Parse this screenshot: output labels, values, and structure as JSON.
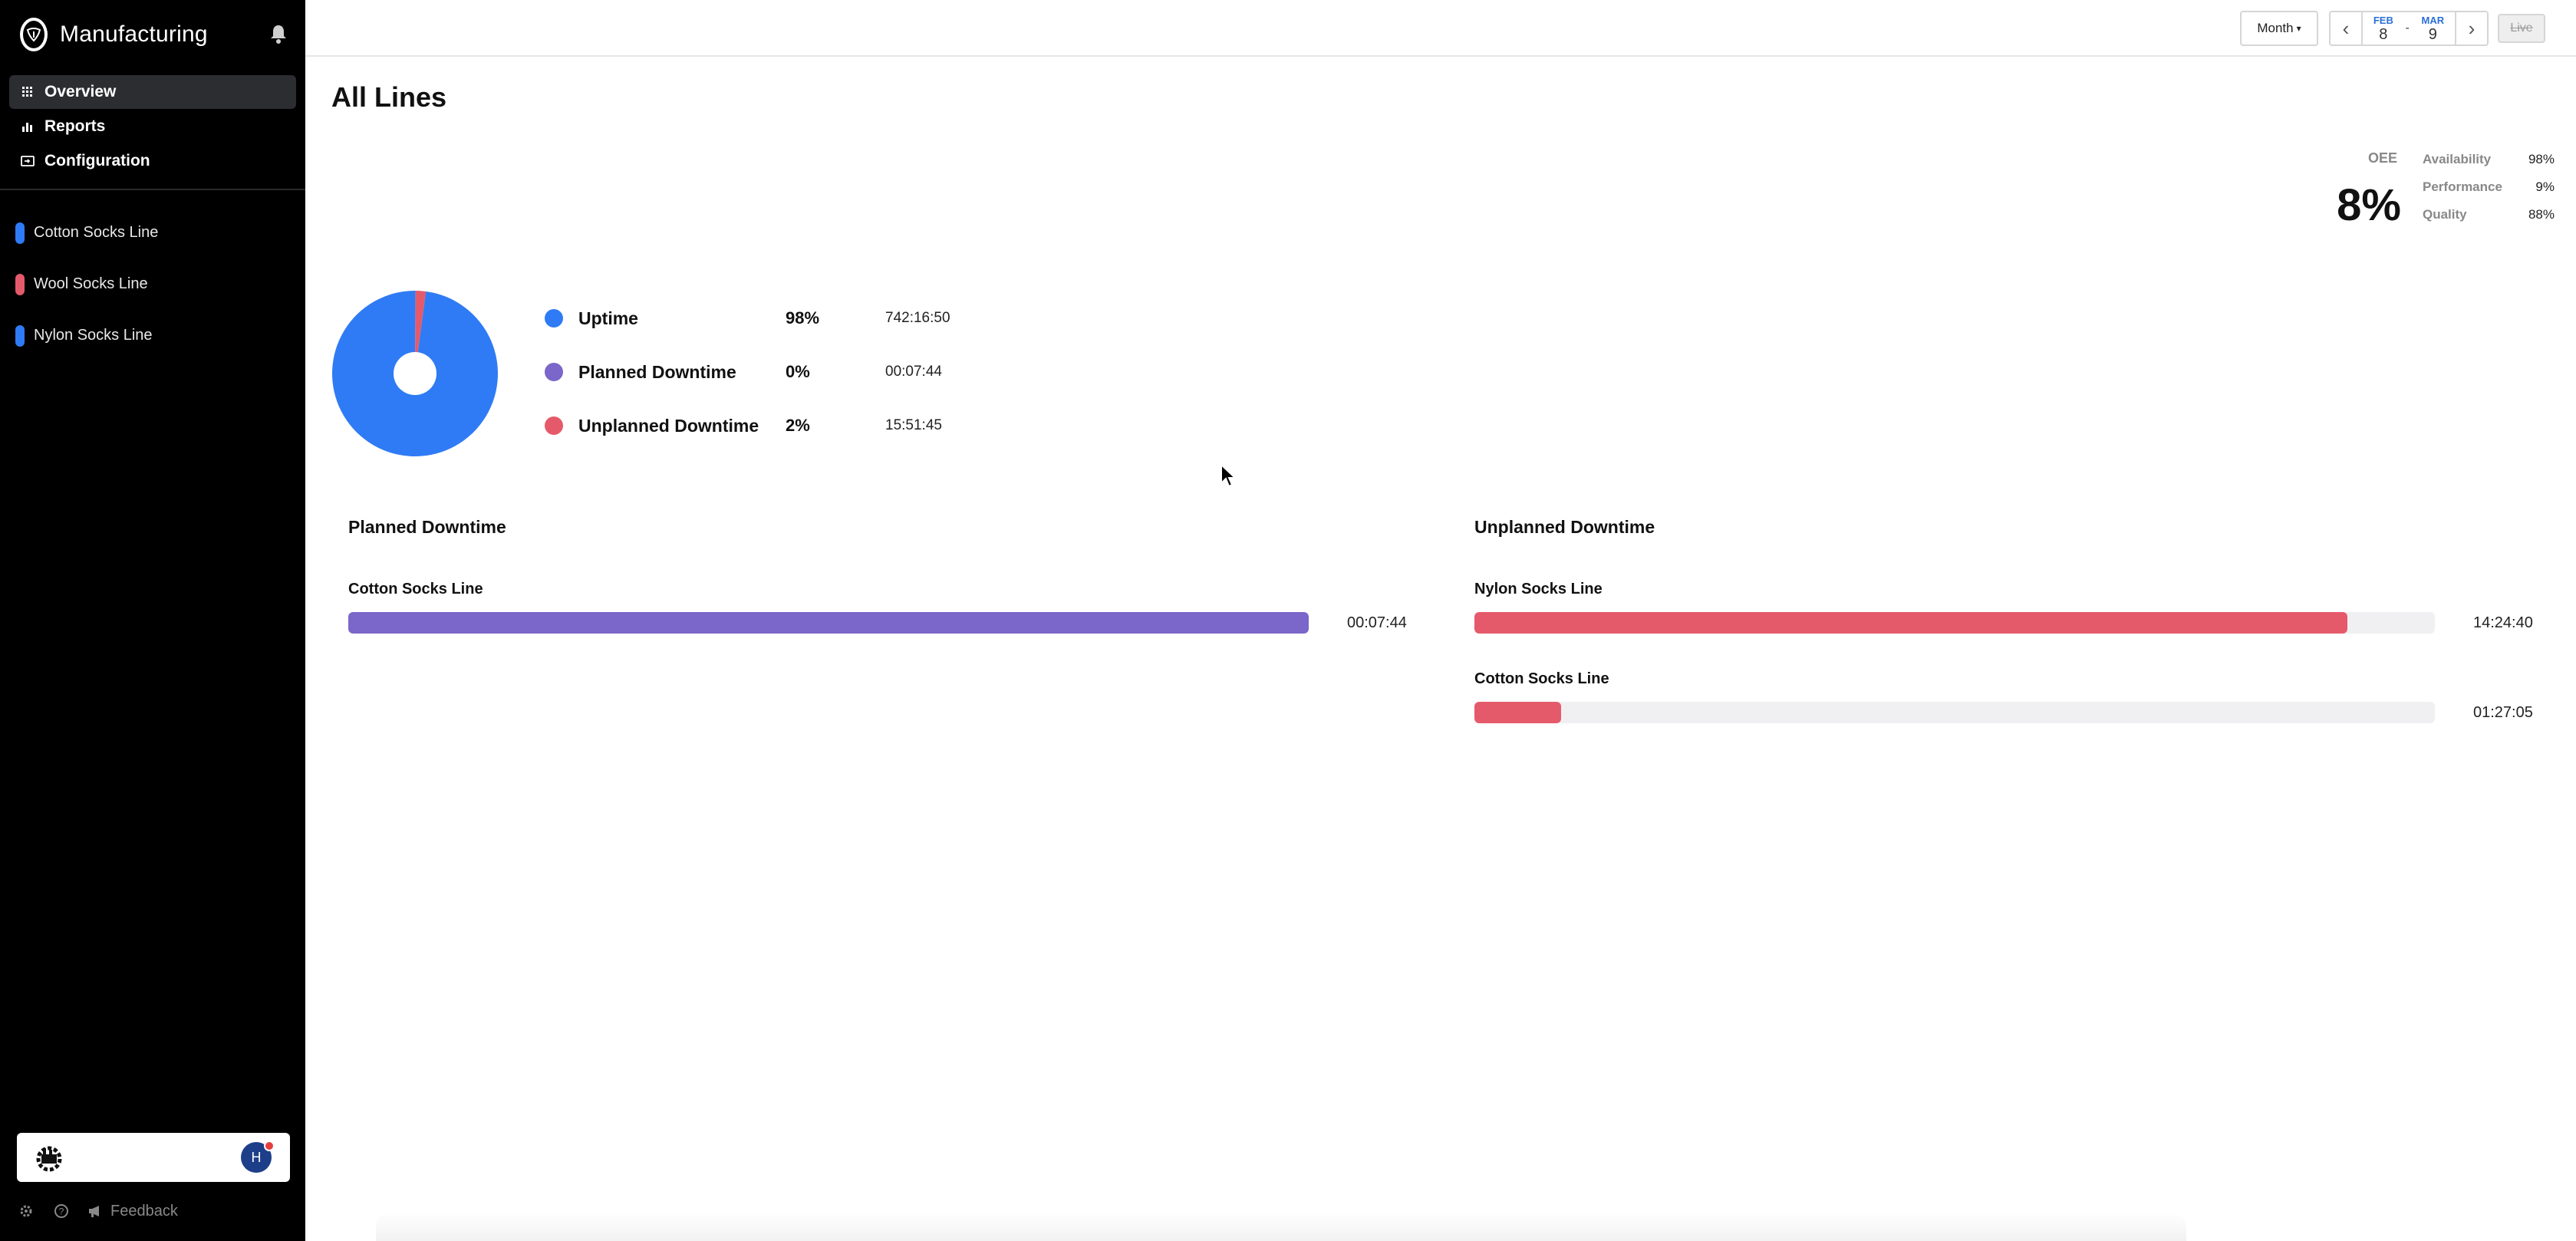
{
  "app": {
    "title": "Manufacturing"
  },
  "nav": [
    {
      "label": "Overview",
      "icon": "grid-icon"
    },
    {
      "label": "Reports",
      "icon": "bar-chart-icon"
    },
    {
      "label": "Configuration",
      "icon": "config-icon"
    }
  ],
  "lines": [
    {
      "label": "Cotton Socks Line",
      "color": "#2f7bf5"
    },
    {
      "label": "Wool Socks Line",
      "color": "#e55a6a"
    },
    {
      "label": "Nylon Socks Line",
      "color": "#2f7bf5"
    }
  ],
  "user": {
    "initial": "H"
  },
  "footer": {
    "feedback": "Feedback"
  },
  "toolbar": {
    "period": "Month",
    "start_month": "FEB",
    "start_day": "8",
    "end_month": "MAR",
    "end_day": "9",
    "separator": "-",
    "live": "Live"
  },
  "page": {
    "title": "All Lines"
  },
  "oee": {
    "label": "OEE",
    "value": "8%",
    "availability_label": "Availability",
    "availability": "98%",
    "performance_label": "Performance",
    "performance": "9%",
    "quality_label": "Quality",
    "quality": "88%"
  },
  "summary": [
    {
      "name": "Uptime",
      "percent": "98%",
      "time": "742:16:50",
      "color": "#2f7bf5",
      "value": 98
    },
    {
      "name": "Planned Downtime",
      "percent": "0%",
      "time": "00:07:44",
      "color": "#7b66c9",
      "value": 0.02
    },
    {
      "name": "Unplanned Downtime",
      "percent": "2%",
      "time": "15:51:45",
      "color": "#e55a6a",
      "value": 2
    }
  ],
  "planned": {
    "title": "Planned Downtime",
    "items": [
      {
        "label": "Cotton Socks Line",
        "time": "00:07:44",
        "fraction": 1.0,
        "color": "#7b66c9"
      }
    ]
  },
  "unplanned": {
    "title": "Unplanned Downtime",
    "items": [
      {
        "label": "Nylon Socks Line",
        "time": "14:24:40",
        "fraction": 0.909,
        "color": "#e55a6a"
      },
      {
        "label": "Cotton Socks Line",
        "time": "01:27:05",
        "fraction": 0.09,
        "color": "#e55a6a"
      }
    ]
  }
}
